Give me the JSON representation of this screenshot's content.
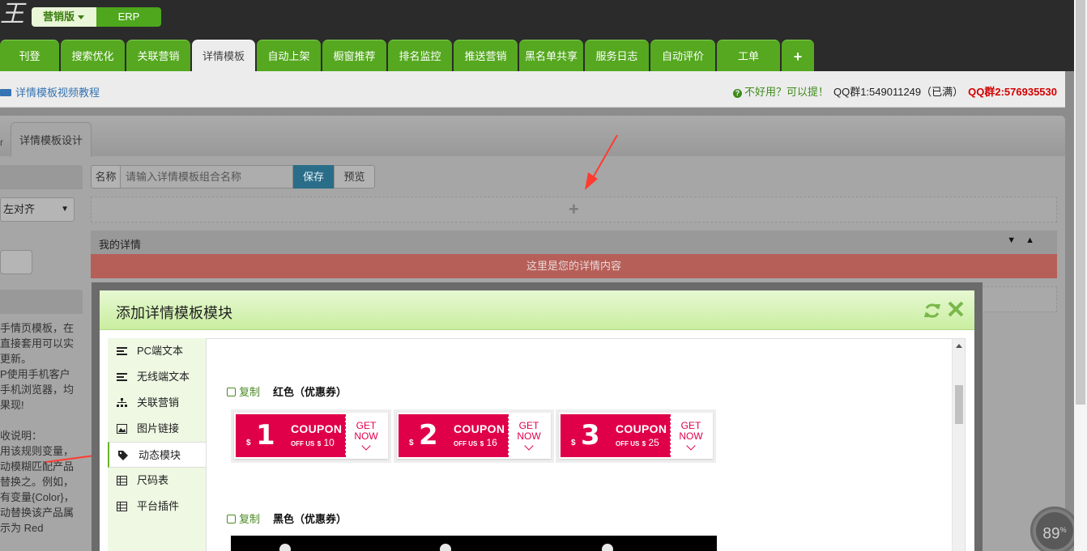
{
  "header": {
    "logo_glyph": "王",
    "edition_selected": "营销版",
    "edition_other": "ERP",
    "tabs": [
      {
        "label": "刊登"
      },
      {
        "label": "搜索优化"
      },
      {
        "label": "关联营销"
      },
      {
        "label": "详情模板"
      },
      {
        "label": "自动上架"
      },
      {
        "label": "橱窗推荐"
      },
      {
        "label": "排名监控"
      },
      {
        "label": "推送营销"
      },
      {
        "label": "黑名单共享"
      },
      {
        "label": "服务日志"
      },
      {
        "label": "自动评价"
      },
      {
        "label": "工单"
      },
      {
        "label": "+"
      }
    ],
    "active_tab_index": 3
  },
  "subbar": {
    "video_link": "详情模板视频教程",
    "feedback": "不好用？可以提！",
    "qq1": "QQ群1:549011249（已满）",
    "qq2": "QQ群2:576935530"
  },
  "main": {
    "tab_stub": "r",
    "tab_label": "详情模板设计",
    "align_select": "左对齐",
    "name_label": "名称",
    "name_placeholder": "请输入详情模板组合名称",
    "save_label": "保存",
    "preview_label": "预览",
    "add_symbol": "+",
    "my_details_title": "我的详情",
    "my_details_content": "这里是您的详情内容",
    "help_text": "手情页模板，在\n直接套用可以实\n更新。\nP使用手机客户\n手机浏览器，均\n果现!\n\n收说明：\n用该规则变量，\n动模糊匹配产品\n替换之。例如，\n有变量{Color}，\n动替换该产品属\n示为 Red\n\n注意事项："
  },
  "modal": {
    "title": "添加详情模板模块",
    "sidebar": [
      {
        "label": "PC端文本",
        "icon": "align-left-icon"
      },
      {
        "label": "无线端文本",
        "icon": "align-left-icon"
      },
      {
        "label": "关联营销",
        "icon": "sitemap-icon"
      },
      {
        "label": "图片链接",
        "icon": "image-icon"
      },
      {
        "label": "动态模块",
        "icon": "tag-icon"
      },
      {
        "label": "尺码表",
        "icon": "table-icon"
      },
      {
        "label": "平台插件",
        "icon": "table-icon"
      }
    ],
    "active_index": 4,
    "sections": [
      {
        "copy": "复制",
        "name": "红色（优惠券）"
      },
      {
        "copy": "复制",
        "name": "黑色（优惠券）"
      }
    ],
    "coupons": [
      {
        "currency": "$",
        "number": "1",
        "word": "COUPON",
        "off": "OFF US",
        "off_cur": "$",
        "amount": "10",
        "get": "GET",
        "now": "NOW"
      },
      {
        "currency": "$",
        "number": "2",
        "word": "COUPON",
        "off": "OFF US",
        "off_cur": "$",
        "amount": "16",
        "get": "GET",
        "now": "NOW"
      },
      {
        "currency": "$",
        "number": "3",
        "word": "COUPON",
        "off": "OFF US",
        "off_cur": "$",
        "amount": "25",
        "get": "GET",
        "now": "NOW"
      }
    ]
  },
  "speed": {
    "value": "89",
    "unit": "%"
  },
  "colors": {
    "brand_green": "#55a81f",
    "coupon_red": "#e0004a",
    "qq_red": "#d20000"
  }
}
